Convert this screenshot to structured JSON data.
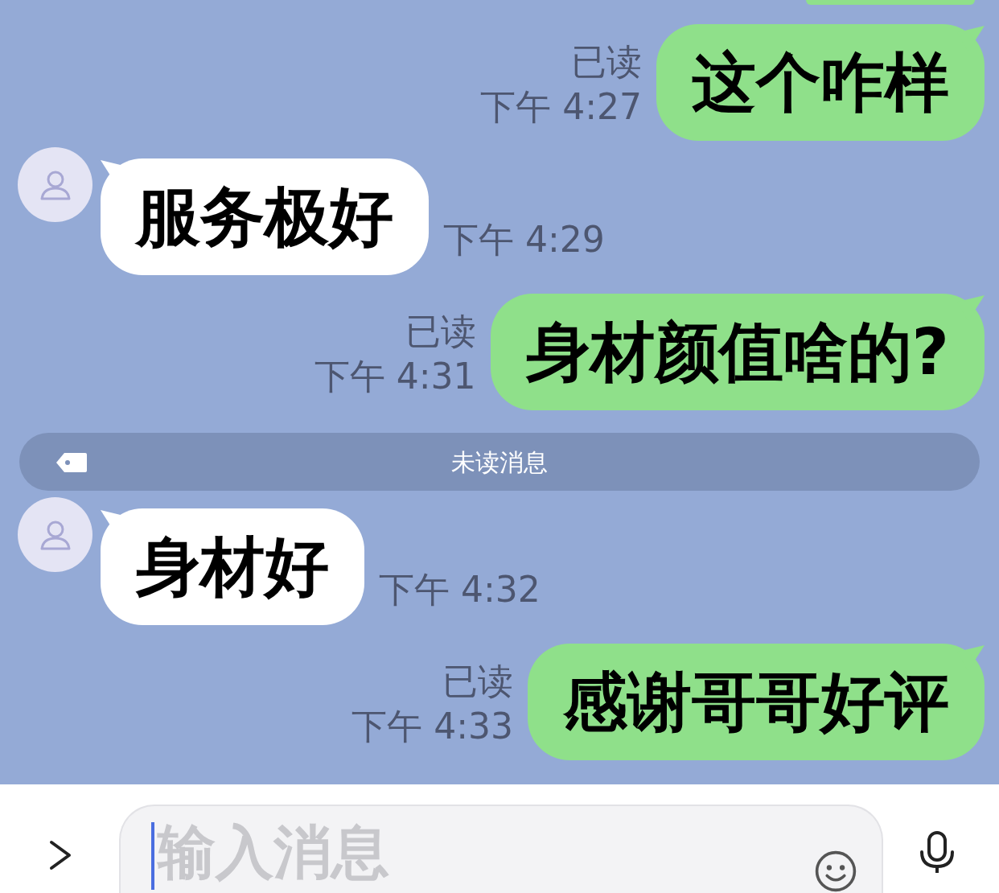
{
  "messages": [
    {
      "kind": "clipped"
    },
    {
      "kind": "outgoing",
      "text": "这个咋样",
      "read_label": "已读",
      "time": "下午 4:27"
    },
    {
      "kind": "incoming",
      "text": "服务极好",
      "time": "下午 4:29"
    },
    {
      "kind": "outgoing",
      "text": "身材颜值啥的?",
      "read_label": "已读",
      "time": "下午 4:31"
    },
    {
      "kind": "divider",
      "label": "未读消息"
    },
    {
      "kind": "incoming",
      "text": "身材好",
      "time": "下午 4:32"
    },
    {
      "kind": "outgoing",
      "text": "感谢哥哥好评",
      "read_label": "已读",
      "time": "下午 4:33"
    }
  ],
  "composer": {
    "placeholder": "输入消息"
  }
}
